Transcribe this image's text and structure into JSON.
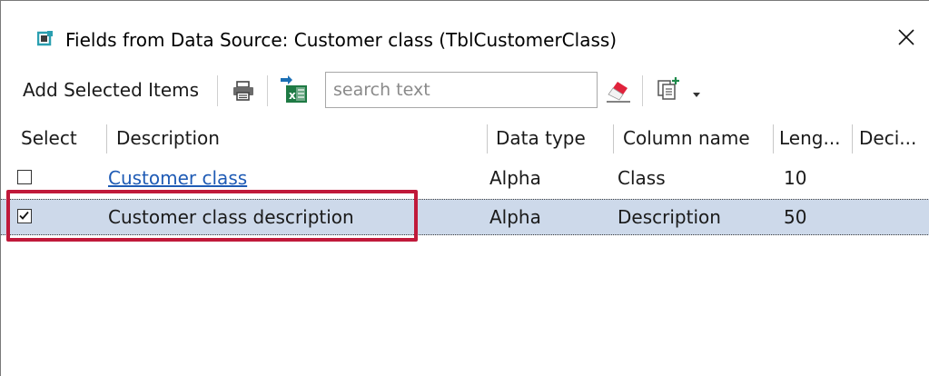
{
  "window": {
    "title": "Fields from Data Source: Customer class (TblCustomerClass)",
    "icon": "app-window-icon",
    "close_glyph": "✕"
  },
  "toolbar": {
    "add_selected_label": "Add Selected Items",
    "search_placeholder": "search text",
    "search_value": "",
    "icons": [
      "print-icon",
      "export-excel-icon",
      "clear-eraser-icon",
      "copy-dropdown-icon"
    ]
  },
  "grid": {
    "columns": [
      "Select",
      "Description",
      "Data type",
      "Column name",
      "Leng...",
      "Deci..."
    ],
    "rows": [
      {
        "checked": false,
        "description": "Customer class",
        "data_type": "Alpha",
        "column_name": "Class",
        "length": "10",
        "decimals": ""
      },
      {
        "checked": true,
        "description": "Customer class description",
        "data_type": "Alpha",
        "column_name": "Description",
        "length": "50",
        "decimals": ""
      }
    ]
  },
  "colors": {
    "selected_row_bg": "#cdd9ea",
    "highlight_border": "#c0193a",
    "link_text": "#1f5bb5",
    "excel_green": "#1e7a44",
    "app_icon_teal": "#2a9fb0"
  }
}
